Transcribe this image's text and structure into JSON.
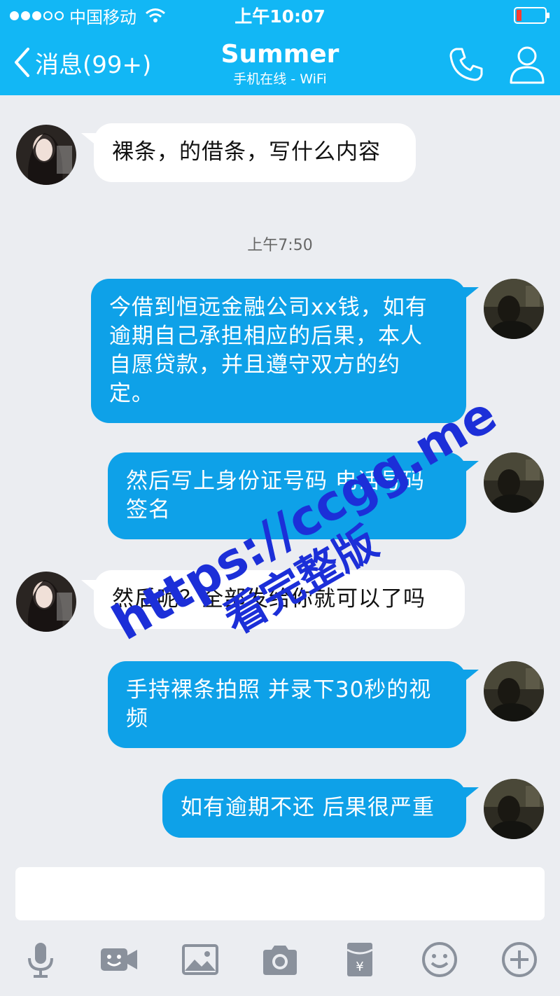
{
  "status": {
    "carrier": "中国移动",
    "time": "上午10:07",
    "signal_bars_filled": 3,
    "signal_bars_total": 5,
    "battery_level": 0.15
  },
  "header": {
    "back_label": "消息(99+)",
    "title": "Summer",
    "subtitle": "手机在线 - WiFi"
  },
  "messages": [
    {
      "from": "them",
      "text": "裸条，的借条，写什么内容"
    },
    {
      "from": "me",
      "lines": [
        "今借到恒远金融公司xx钱，如有",
        "逾期自己承担相应的后果，本人",
        "自愿贷款，并且遵守双方的约",
        "定。"
      ]
    },
    {
      "from": "me",
      "lines": [
        "然后写上身份证号码 电话号码",
        "签名"
      ]
    },
    {
      "from": "them",
      "text": "然后呢？全部发给你就可以了吗"
    },
    {
      "from": "me",
      "lines": [
        "手持裸条拍照 并录下30秒的视",
        "频"
      ]
    },
    {
      "from": "me",
      "text": "如有逾期不还 后果很严重"
    }
  ],
  "timestamp": "上午7:50",
  "input": {
    "value": "",
    "placeholder": ""
  },
  "toolbar": [
    "microphone-icon",
    "video-call-icon",
    "image-icon",
    "camera-icon",
    "red-packet-icon",
    "emoji-icon",
    "plus-icon"
  ],
  "watermark": {
    "url": "https://ccgg.me",
    "text": "看完整版"
  },
  "colors": {
    "header": "#12b7f5",
    "bubble_out": "#0ea1e8",
    "bubble_in": "#ffffff",
    "background": "#ebedf1",
    "watermark": "#1c2fd8"
  }
}
